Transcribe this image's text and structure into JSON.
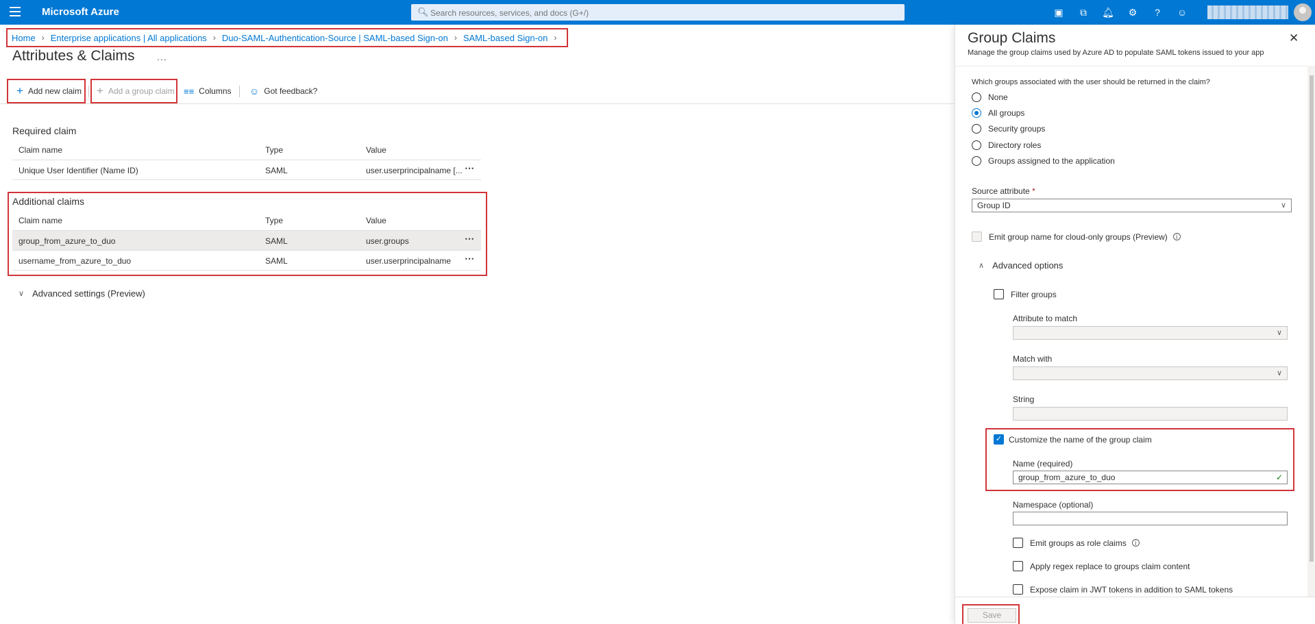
{
  "topbar": {
    "brand": "Microsoft Azure",
    "search_placeholder": "Search resources, services, and docs (G+/)",
    "icons": [
      "cloud-shell-icon",
      "directory-filter-icon",
      "bell-icon",
      "gear-icon",
      "help-icon",
      "feedback-icon"
    ]
  },
  "breadcrumb": [
    "Home",
    "Enterprise applications | All applications",
    "Duo-SAML-Authentication-Source | SAML-based Sign-on",
    "SAML-based Sign-on"
  ],
  "page": {
    "title": "Attributes & Claims",
    "more": "..."
  },
  "toolbar": {
    "add_new_claim": "Add new claim",
    "add_group_claim": "Add a group claim",
    "columns": "Columns",
    "feedback": "Got feedback?"
  },
  "required": {
    "title": "Required claim",
    "headers": [
      "Claim name",
      "Type",
      "Value"
    ],
    "rows": [
      {
        "name": "Unique User Identifier (Name ID)",
        "type": "SAML",
        "value": "user.userprincipalname [..."
      }
    ]
  },
  "additional": {
    "title": "Additional claims",
    "headers": [
      "Claim name",
      "Type",
      "Value"
    ],
    "rows": [
      {
        "name": "group_from_azure_to_duo",
        "type": "SAML",
        "value": "user.groups"
      },
      {
        "name": "username_from_azure_to_duo",
        "type": "SAML",
        "value": "user.userprincipalname"
      }
    ]
  },
  "advanced_settings": "Advanced settings (Preview)",
  "panel": {
    "title": "Group Claims",
    "subtitle": "Manage the group claims used by Azure AD to populate SAML tokens issued to your app",
    "question": "Which groups associated with the user should be returned in the claim?",
    "radios": [
      "None",
      "All groups",
      "Security groups",
      "Directory roles",
      "Groups assigned to the application"
    ],
    "selected_radio": "All groups",
    "source_attribute_label": "Source attribute",
    "required_marker": "*",
    "source_attribute_value": "Group ID",
    "emit_group_name": "Emit group name for cloud-only groups (Preview)",
    "advanced_options": "Advanced options",
    "filter_groups": "Filter groups",
    "attribute_to_match": "Attribute to match",
    "match_with": "Match with",
    "string": "String",
    "customize_name": "Customize the name of the group claim",
    "name_label": "Name (required)",
    "name_value": "group_from_azure_to_duo",
    "namespace_label": "Namespace (optional)",
    "emit_as_role": "Emit groups as role claims",
    "regex_replace": "Apply regex replace to groups claim content",
    "expose_jwt": "Expose claim in JWT tokens in addition to SAML tokens",
    "save": "Save"
  }
}
